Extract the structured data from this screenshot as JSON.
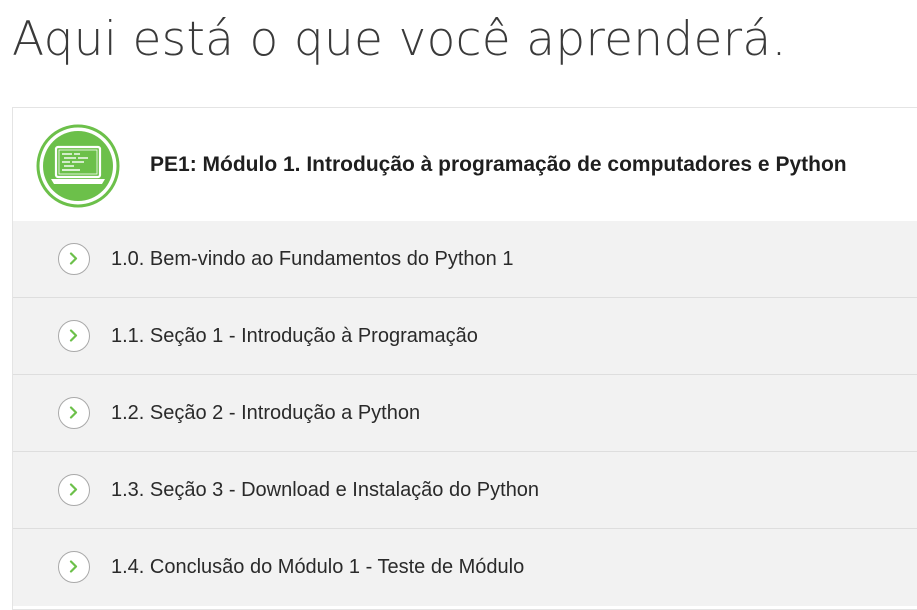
{
  "page": {
    "heading": "Aqui está o que você aprenderá."
  },
  "module": {
    "icon": "laptop-code-icon",
    "title": "PE1: Módulo 1. Introdução à programação de computadores e Python",
    "lessons": [
      {
        "label": "1.0. Bem-vindo ao Fundamentos do Python 1",
        "icon": "chevron-right-icon"
      },
      {
        "label": "1.1. Seção 1 - Introdução à Programação",
        "icon": "chevron-right-icon"
      },
      {
        "label": "1.2. Seção 2 - Introdução a Python",
        "icon": "chevron-right-icon"
      },
      {
        "label": "1.3. Seção 3 - Download e Instalação do Python",
        "icon": "chevron-right-icon"
      },
      {
        "label": "1.4. Conclusão do Módulo 1 - Teste de Módulo",
        "icon": "chevron-right-icon"
      }
    ]
  },
  "colors": {
    "accent_green": "#6cc04a",
    "row_background": "#f2f2f2",
    "divider": "#dedede"
  }
}
